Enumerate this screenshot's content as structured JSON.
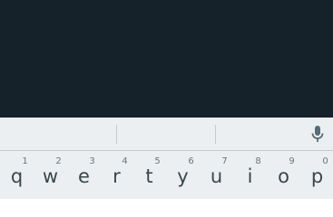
{
  "colors": {
    "app_background": "#15222a",
    "keyboard_background": "#eceff1",
    "suggestion_strip_background": "#eceff1",
    "divider": "#c5cacd",
    "key_letter": "#37474f",
    "key_hint": "#6b7479",
    "mic_icon": "#546e7a"
  },
  "keyboard": {
    "suggestions": [
      "",
      "",
      ""
    ],
    "voice_input_icon": "microphone-icon",
    "rows": [
      {
        "keys": [
          {
            "letter": "q",
            "hint": "1"
          },
          {
            "letter": "w",
            "hint": "2"
          },
          {
            "letter": "e",
            "hint": "3"
          },
          {
            "letter": "r",
            "hint": "4"
          },
          {
            "letter": "t",
            "hint": "5"
          },
          {
            "letter": "y",
            "hint": "6"
          },
          {
            "letter": "u",
            "hint": "7"
          },
          {
            "letter": "i",
            "hint": "8"
          },
          {
            "letter": "o",
            "hint": "9"
          },
          {
            "letter": "p",
            "hint": "0"
          }
        ]
      }
    ]
  }
}
